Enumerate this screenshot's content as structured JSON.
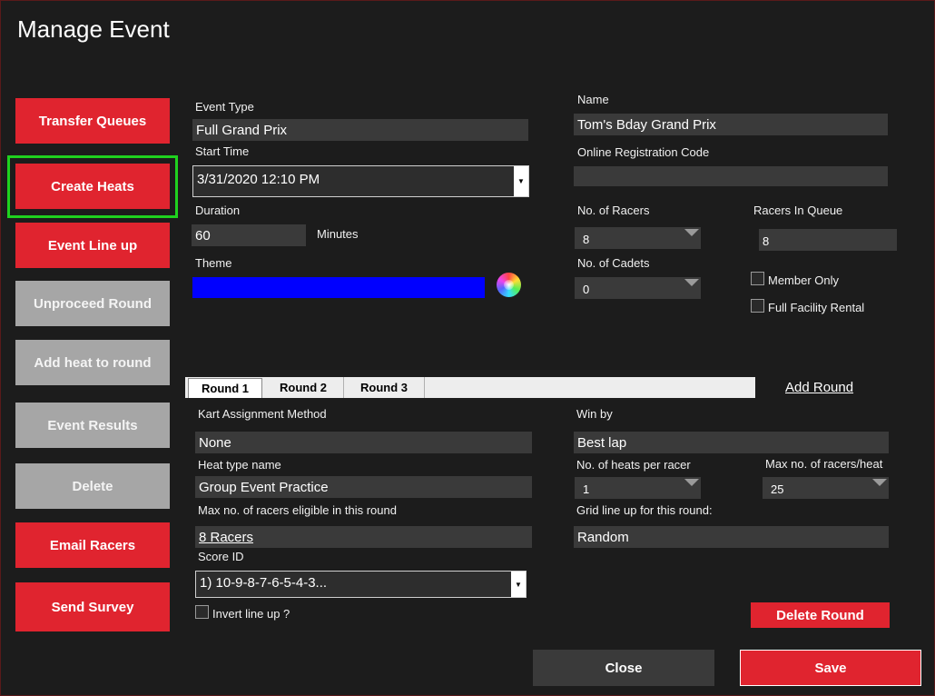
{
  "window": {
    "title": "Manage Event"
  },
  "sidebar": {
    "transfer_queues": "Transfer Queues",
    "create_heats": "Create Heats",
    "event_line_up": "Event Line up",
    "unproceed_round": "Unproceed Round",
    "add_heat_to_round": "Add heat to round",
    "event_results": "Event Results",
    "delete": "Delete",
    "email_racers": "Email Racers",
    "send_survey": "Send Survey"
  },
  "event": {
    "event_type_label": "Event Type",
    "event_type_value": "Full Grand Prix",
    "start_time_label": "Start Time",
    "start_time_value": "3/31/2020 12:10 PM",
    "duration_label": "Duration",
    "duration_value": "60",
    "duration_unit": "Minutes",
    "theme_label": "Theme",
    "theme_color": "#0000ff",
    "name_label": "Name",
    "name_value": "Tom's Bday Grand Prix",
    "online_code_label": "Online Registration Code",
    "online_code_value": "",
    "racers_label": "No. of Racers",
    "racers_value": "8",
    "queue_label": "Racers In Queue",
    "queue_value": "8",
    "cadets_label": "No. of Cadets",
    "cadets_value": "0",
    "member_only_label": "Member Only",
    "member_only_checked": false,
    "full_facility_label": "Full Facility Rental",
    "full_facility_checked": false
  },
  "rounds": {
    "tabs": [
      "Round 1",
      "Round 2",
      "Round 3"
    ],
    "active_tab": 0,
    "add_round": "Add Round"
  },
  "round": {
    "kart_method_label": "Kart Assignment Method",
    "kart_method_value": "None",
    "heat_type_label": "Heat type name",
    "heat_type_value": "Group Event Practice",
    "max_eligible_label": "Max no. of racers eligible in this round",
    "max_eligible_value": "8 Racers",
    "score_id_label": "Score ID",
    "score_id_value": "1) 10-9-8-7-6-5-4-3...",
    "invert_label": "Invert line up ?",
    "invert_checked": false,
    "win_by_label": "Win by",
    "win_by_value": "Best lap",
    "heats_per_racer_label": "No. of heats per racer",
    "heats_per_racer_value": "1",
    "max_per_heat_label": "Max no. of racers/heat",
    "max_per_heat_value": "25",
    "grid_label": "Grid line up for this round:",
    "grid_value": "Random",
    "delete_round": "Delete Round"
  },
  "footer": {
    "close": "Close",
    "save": "Save"
  },
  "colors": {
    "accent_red": "#e0242f",
    "disabled_gray": "#a6a6a6",
    "focus_green": "#1fd21f"
  }
}
